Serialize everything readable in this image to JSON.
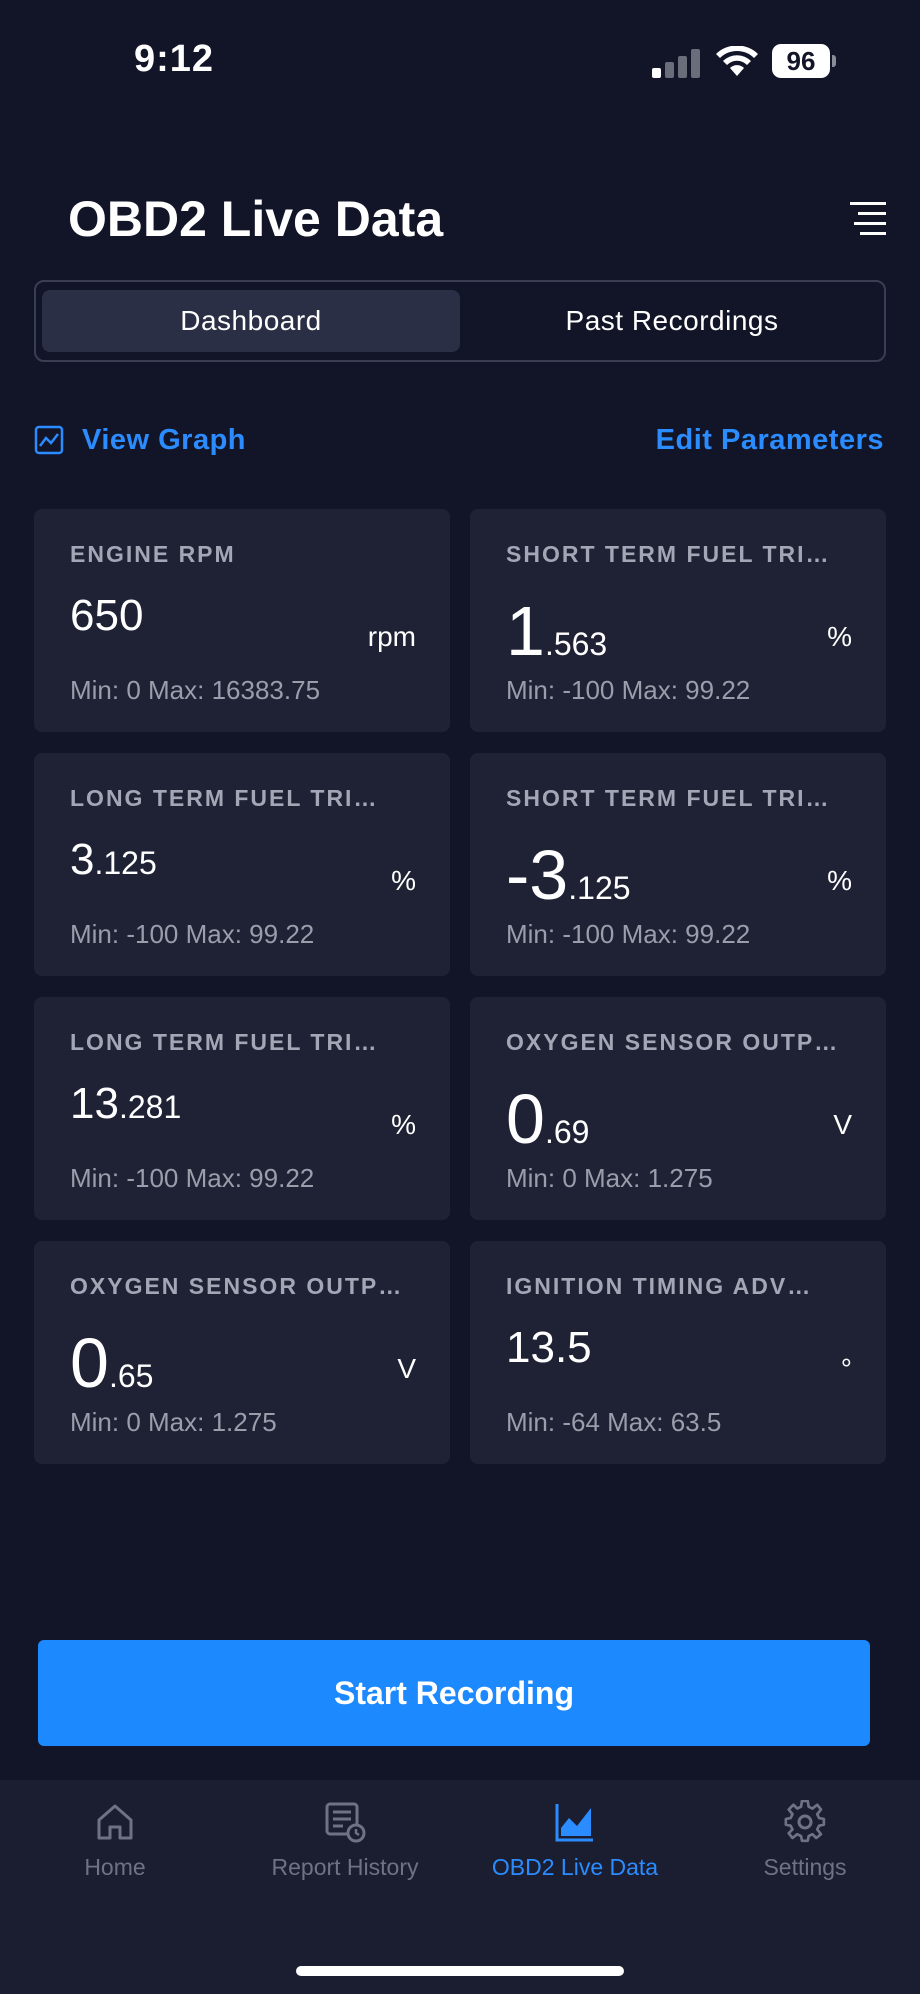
{
  "status_bar": {
    "time": "9:12",
    "battery": "96"
  },
  "header": {
    "title": "OBD2 Live Data"
  },
  "segments": {
    "dashboard": "Dashboard",
    "past": "Past Recordings"
  },
  "links": {
    "view_graph": "View Graph",
    "edit_parameters": "Edit Parameters"
  },
  "cards": [
    {
      "title": "ENGINE RPM",
      "int": "650",
      "frac": "",
      "size": "md",
      "unit": "rpm",
      "minmax": "Min: 0 Max: 16383.75"
    },
    {
      "title": "SHORT TERM FUEL TRI…",
      "int": "1",
      "frac": ".563",
      "size": "lg",
      "unit": "%",
      "minmax": "Min: -100 Max: 99.22"
    },
    {
      "title": "LONG TERM FUEL TRI…",
      "int": "3",
      "frac": ".125",
      "size": "md",
      "unit": "%",
      "minmax": "Min: -100 Max: 99.22"
    },
    {
      "title": "SHORT TERM FUEL TRI…",
      "int": "-3",
      "frac": ".125",
      "size": "lg",
      "unit": "%",
      "minmax": "Min: -100 Max: 99.22"
    },
    {
      "title": "LONG TERM FUEL TRI…",
      "int": "13",
      "frac": ".281",
      "size": "md",
      "unit": "%",
      "minmax": "Min: -100 Max: 99.22"
    },
    {
      "title": "OXYGEN SENSOR OUTP…",
      "int": "0",
      "frac": ".69",
      "size": "lg",
      "unit": "V",
      "minmax": "Min: 0 Max: 1.275"
    },
    {
      "title": "OXYGEN SENSOR OUTP…",
      "int": "0",
      "frac": ".65",
      "size": "lg",
      "unit": "V",
      "minmax": "Min: 0 Max: 1.275"
    },
    {
      "title": "IGNITION TIMING ADV…",
      "int": "13.5",
      "frac": "",
      "size": "md",
      "unit": "°",
      "minmax": "Min: -64 Max: 63.5"
    }
  ],
  "record_button": "Start Recording",
  "tabs": [
    {
      "label": "Home",
      "icon": "home-icon"
    },
    {
      "label": "Report History",
      "icon": "report-history-icon"
    },
    {
      "label": "OBD2 Live Data",
      "icon": "chart-icon"
    },
    {
      "label": "Settings",
      "icon": "gear-icon"
    }
  ],
  "colors": {
    "background": "#121527",
    "card": "#1f2235",
    "accent": "#1d89ff",
    "link": "#2b8cff",
    "muted": "#9a9daa"
  }
}
